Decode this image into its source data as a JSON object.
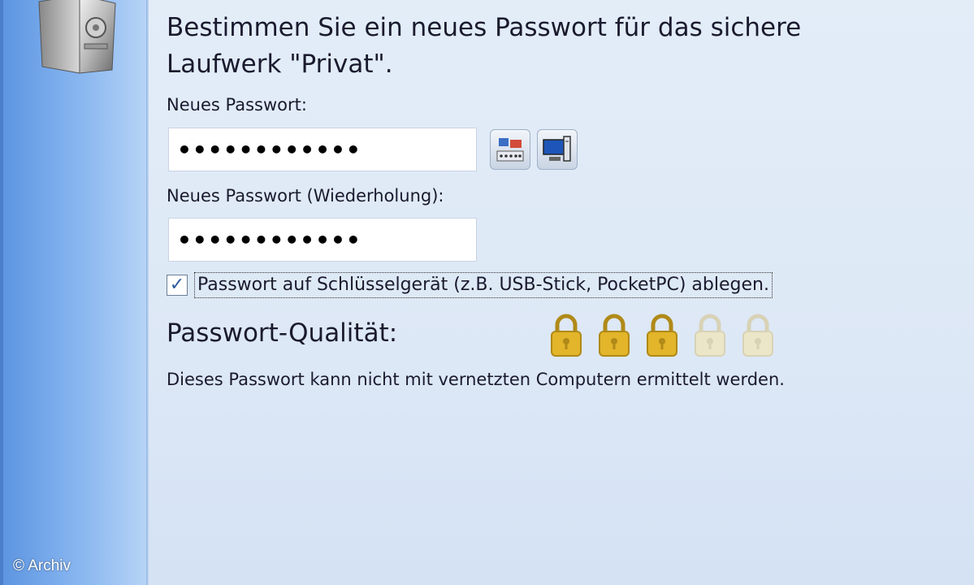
{
  "heading": "Bestimmen Sie ein neues Passwort für das sichere Laufwerk \"Privat\".",
  "new_password": {
    "label": "Neues Passwort:",
    "value": "••••••••••••"
  },
  "repeat_password": {
    "label": "Neues Passwort (Wiederholung):",
    "value": "••••••••••••"
  },
  "tools": [
    {
      "icon": "virtual-keyboard-icon"
    },
    {
      "icon": "computer-device-icon"
    }
  ],
  "store_on_key_device": {
    "label": "Passwort auf Schlüsselgerät (z.B. USB-Stick, PocketPC) ablegen.",
    "checked": true
  },
  "quality": {
    "label": "Passwort-Qualität:",
    "level": 3,
    "max": 5
  },
  "info": "Dieses Passwort kann nicht mit vernetzten Computern ermittelt werden.",
  "watermark": "© Archiv",
  "colors": {
    "side_panel": "#79abec",
    "lock_active": "#e2b52a",
    "lock_inactive": "#ece6c8"
  }
}
